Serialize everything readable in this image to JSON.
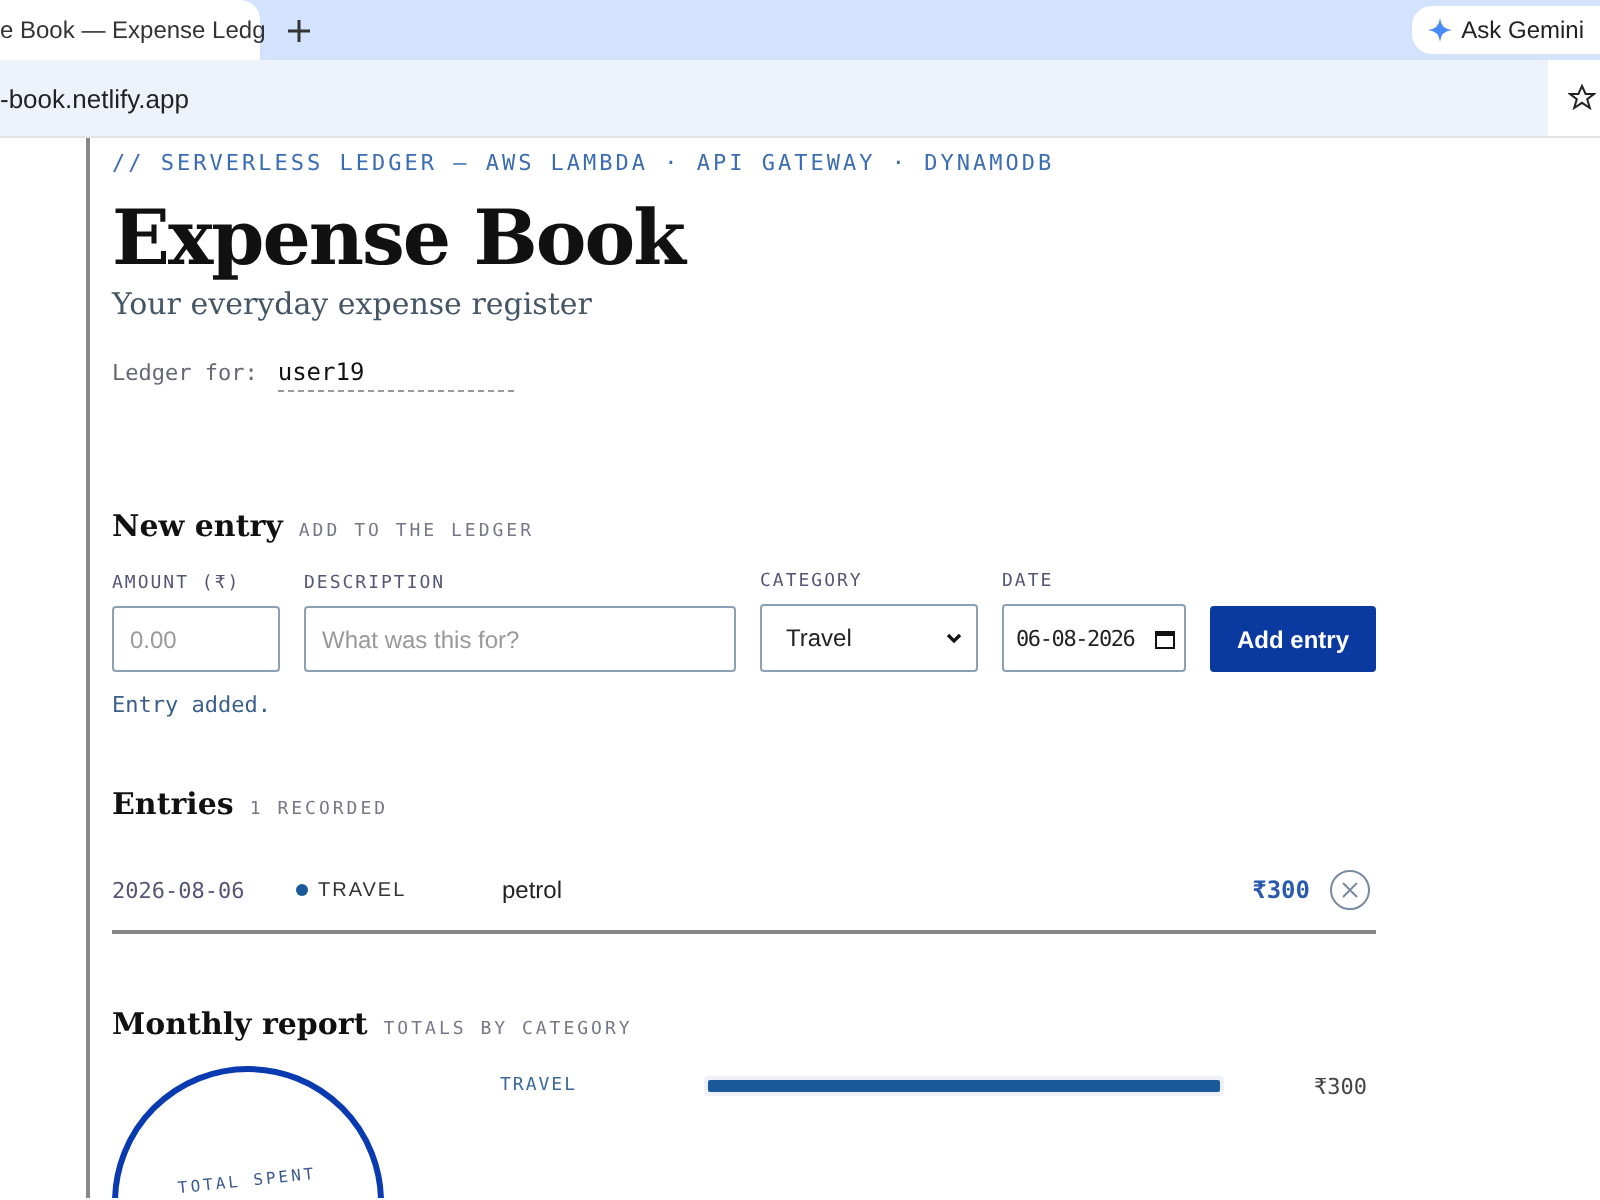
{
  "browser": {
    "tab_title": "e Book — Expense Ledg",
    "address": "-book.netlify.app",
    "gemini_button": "Ask Gemini"
  },
  "header": {
    "kicker": "// SERVERLESS LEDGER — AWS LAMBDA · API GATEWAY · DYNAMODB",
    "title": "Expense Book",
    "subtitle": "Your everyday expense register",
    "ledger_label": "Ledger for:",
    "ledger_user": "user19"
  },
  "new_entry": {
    "title": "New entry",
    "caption": "ADD TO THE LEDGER",
    "fields": [
      {
        "kind": "input",
        "label": "AMOUNT (₹)",
        "placeholder": "0.00"
      },
      {
        "kind": "input",
        "label": "DESCRIPTION",
        "placeholder": "What was this for?"
      },
      {
        "kind": "select",
        "label": "CATEGORY",
        "value": "Travel"
      },
      {
        "kind": "date",
        "label": "DATE",
        "value": "06-08-2026"
      }
    ],
    "button": "Add entry",
    "status": "Entry added."
  },
  "entries": {
    "title": "Entries",
    "caption": "1 RECORDED",
    "rows": [
      {
        "date": "2026-08-06",
        "category": "TRAVEL",
        "color": "#1a5a9a",
        "description": "petrol",
        "amount": "₹300"
      }
    ]
  },
  "report": {
    "title": "Monthly report",
    "caption": "TOTALS BY CATEGORY",
    "total_label": "TOTAL SPENT",
    "rows": [
      {
        "category": "TRAVEL",
        "level": 1,
        "amount": "₹300"
      }
    ]
  }
}
